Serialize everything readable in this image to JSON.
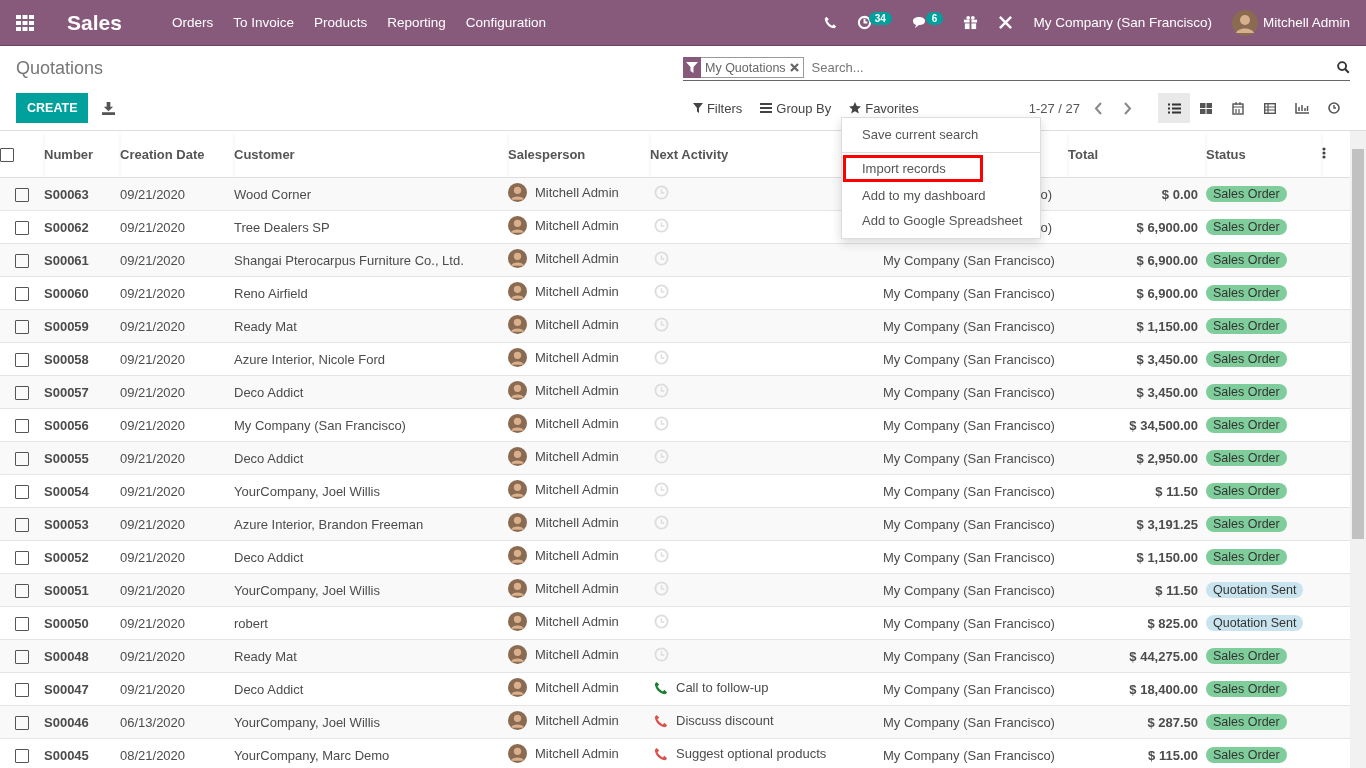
{
  "topbar": {
    "app": "Sales",
    "menu": [
      "Orders",
      "To Invoice",
      "Products",
      "Reporting",
      "Configuration"
    ],
    "activity_count": "34",
    "message_count": "6",
    "company": "My Company (San Francisco)",
    "user": "Mitchell Admin"
  },
  "page": {
    "title": "Quotations",
    "create": "CREATE"
  },
  "search": {
    "facet": "My Quotations",
    "placeholder": "Search..."
  },
  "toolbar": {
    "filters": "Filters",
    "group_by": "Group By",
    "favorites": "Favorites",
    "pager": "1-27 / 27"
  },
  "views": [
    {
      "kind": "list",
      "selected": true
    },
    {
      "kind": "kanban",
      "selected": false
    },
    {
      "kind": "calendar",
      "selected": false
    },
    {
      "kind": "pivot",
      "selected": false
    },
    {
      "kind": "graph",
      "selected": false
    },
    {
      "kind": "activity",
      "selected": false
    }
  ],
  "favorites_menu": [
    {
      "label": "Save current search",
      "highlighted": false,
      "divider_after": true
    },
    {
      "label": "Import records",
      "highlighted": true,
      "divider_after": false
    },
    {
      "label": "Add to my dashboard",
      "highlighted": false,
      "divider_after": false
    },
    {
      "label": "Add to Google Spreadsheet",
      "highlighted": false,
      "divider_after": false
    }
  ],
  "columns": [
    "Number",
    "Creation Date",
    "Customer",
    "Salesperson",
    "Next Activity",
    "Total",
    "Status"
  ],
  "select_all_checked": false,
  "rows": [
    {
      "checked": false,
      "number": "S00063",
      "date": "09/21/2020",
      "customer": "Wood Corner",
      "salesperson": "Mitchell Admin",
      "activity": {
        "kind": "clock"
      },
      "company": "o)",
      "total": "$ 0.00",
      "status": {
        "text": "Sales Order",
        "color": "#7fcd9b"
      }
    },
    {
      "checked": false,
      "number": "S00062",
      "date": "09/21/2020",
      "customer": "Tree Dealers SP",
      "salesperson": "Mitchell Admin",
      "activity": {
        "kind": "clock"
      },
      "company": "o)",
      "total": "$ 6,900.00",
      "status": {
        "text": "Sales Order",
        "color": "#7fcd9b"
      }
    },
    {
      "checked": false,
      "number": "S00061",
      "date": "09/21/2020",
      "customer": "Shangai Pterocarpus Furniture Co., Ltd.",
      "salesperson": "Mitchell Admin",
      "activity": {
        "kind": "clock"
      },
      "company": "My Company (San Francisco)",
      "total": "$ 6,900.00",
      "status": {
        "text": "Sales Order",
        "color": "#7fcd9b"
      }
    },
    {
      "checked": false,
      "number": "S00060",
      "date": "09/21/2020",
      "customer": "Reno Airfield",
      "salesperson": "Mitchell Admin",
      "activity": {
        "kind": "clock"
      },
      "company": "My Company (San Francisco)",
      "total": "$ 6,900.00",
      "status": {
        "text": "Sales Order",
        "color": "#7fcd9b"
      }
    },
    {
      "checked": false,
      "number": "S00059",
      "date": "09/21/2020",
      "customer": "Ready Mat",
      "salesperson": "Mitchell Admin",
      "activity": {
        "kind": "clock"
      },
      "company": "My Company (San Francisco)",
      "total": "$ 1,150.00",
      "status": {
        "text": "Sales Order",
        "color": "#7fcd9b"
      }
    },
    {
      "checked": false,
      "number": "S00058",
      "date": "09/21/2020",
      "customer": "Azure Interior, Nicole Ford",
      "salesperson": "Mitchell Admin",
      "activity": {
        "kind": "clock"
      },
      "company": "My Company (San Francisco)",
      "total": "$ 3,450.00",
      "status": {
        "text": "Sales Order",
        "color": "#7fcd9b"
      }
    },
    {
      "checked": false,
      "number": "S00057",
      "date": "09/21/2020",
      "customer": "Deco Addict",
      "salesperson": "Mitchell Admin",
      "activity": {
        "kind": "clock"
      },
      "company": "My Company (San Francisco)",
      "total": "$ 3,450.00",
      "status": {
        "text": "Sales Order",
        "color": "#7fcd9b"
      }
    },
    {
      "checked": false,
      "number": "S00056",
      "date": "09/21/2020",
      "customer": "My Company (San Francisco)",
      "salesperson": "Mitchell Admin",
      "activity": {
        "kind": "clock"
      },
      "company": "My Company (San Francisco)",
      "total": "$ 34,500.00",
      "status": {
        "text": "Sales Order",
        "color": "#7fcd9b"
      }
    },
    {
      "checked": false,
      "number": "S00055",
      "date": "09/21/2020",
      "customer": "Deco Addict",
      "salesperson": "Mitchell Admin",
      "activity": {
        "kind": "clock"
      },
      "company": "My Company (San Francisco)",
      "total": "$ 2,950.00",
      "status": {
        "text": "Sales Order",
        "color": "#7fcd9b"
      }
    },
    {
      "checked": false,
      "number": "S00054",
      "date": "09/21/2020",
      "customer": "YourCompany, Joel Willis",
      "salesperson": "Mitchell Admin",
      "activity": {
        "kind": "clock"
      },
      "company": "My Company (San Francisco)",
      "total": "$ 11.50",
      "status": {
        "text": "Sales Order",
        "color": "#7fcd9b"
      }
    },
    {
      "checked": false,
      "number": "S00053",
      "date": "09/21/2020",
      "customer": "Azure Interior, Brandon Freeman",
      "salesperson": "Mitchell Admin",
      "activity": {
        "kind": "clock"
      },
      "company": "My Company (San Francisco)",
      "total": "$ 3,191.25",
      "status": {
        "text": "Sales Order",
        "color": "#7fcd9b"
      }
    },
    {
      "checked": false,
      "number": "S00052",
      "date": "09/21/2020",
      "customer": "Deco Addict",
      "salesperson": "Mitchell Admin",
      "activity": {
        "kind": "clock"
      },
      "company": "My Company (San Francisco)",
      "total": "$ 1,150.00",
      "status": {
        "text": "Sales Order",
        "color": "#7fcd9b"
      }
    },
    {
      "checked": false,
      "number": "S00051",
      "date": "09/21/2020",
      "customer": "YourCompany, Joel Willis",
      "salesperson": "Mitchell Admin",
      "activity": {
        "kind": "clock"
      },
      "company": "My Company (San Francisco)",
      "total": "$ 11.50",
      "status": {
        "text": "Quotation Sent",
        "color": "#c9e4ee"
      }
    },
    {
      "checked": false,
      "number": "S00050",
      "date": "09/21/2020",
      "customer": "robert",
      "salesperson": "Mitchell Admin",
      "activity": {
        "kind": "clock"
      },
      "company": "My Company (San Francisco)",
      "total": "$ 825.00",
      "status": {
        "text": "Quotation Sent",
        "color": "#c9e4ee"
      }
    },
    {
      "checked": false,
      "number": "S00048",
      "date": "09/21/2020",
      "customer": "Ready Mat",
      "salesperson": "Mitchell Admin",
      "activity": {
        "kind": "clock"
      },
      "company": "My Company (San Francisco)",
      "total": "$ 44,275.00",
      "status": {
        "text": "Sales Order",
        "color": "#7fcd9b"
      }
    },
    {
      "checked": false,
      "number": "S00047",
      "date": "09/21/2020",
      "customer": "Deco Addict",
      "salesperson": "Mitchell Admin",
      "activity": {
        "kind": "phone",
        "color": "#1e7e34",
        "text": "Call to follow-up"
      },
      "company": "My Company (San Francisco)",
      "total": "$ 18,400.00",
      "status": {
        "text": "Sales Order",
        "color": "#7fcd9b"
      }
    },
    {
      "checked": false,
      "number": "S00046",
      "date": "06/13/2020",
      "customer": "YourCompany, Joel Willis",
      "salesperson": "Mitchell Admin",
      "activity": {
        "kind": "phone",
        "color": "#d9534f",
        "text": "Discuss discount"
      },
      "company": "My Company (San Francisco)",
      "total": "$ 287.50",
      "status": {
        "text": "Sales Order",
        "color": "#7fcd9b"
      }
    },
    {
      "checked": false,
      "number": "S00045",
      "date": "08/21/2020",
      "customer": "YourCompany, Marc Demo",
      "salesperson": "Mitchell Admin",
      "activity": {
        "kind": "phone",
        "color": "#d9534f",
        "text": "Suggest optional products"
      },
      "company": "My Company (San Francisco)",
      "total": "$ 115.00",
      "status": {
        "text": "Sales Order",
        "color": "#7fcd9b"
      }
    }
  ]
}
